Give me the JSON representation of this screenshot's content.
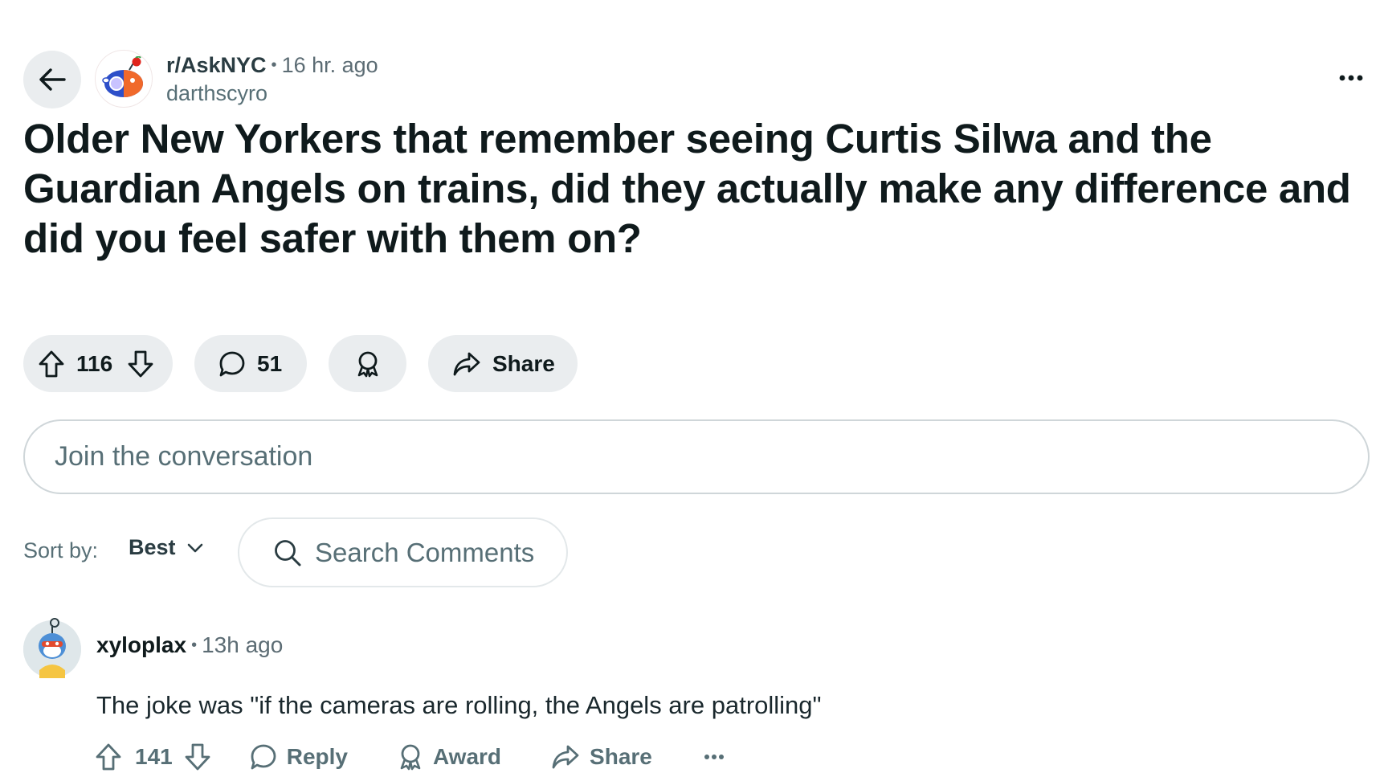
{
  "post": {
    "subreddit": "r/AskNYC",
    "separator": "•",
    "time_ago": "16 hr. ago",
    "author": "darthscyro",
    "title": "Older New Yorkers that remember seeing Curtis Silwa and the Guardian Angels on trains, did they actually make any difference and did you feel safer with them on?",
    "votes": "116",
    "comments": "51",
    "share_label": "Share"
  },
  "composer": {
    "placeholder": "Join the conversation"
  },
  "sort": {
    "label": "Sort by:",
    "value": "Best"
  },
  "search": {
    "placeholder": "Search Comments"
  },
  "comment": {
    "author": "xyloplax",
    "separator": "•",
    "time_ago": "13h ago",
    "body": "The joke was \"if the cameras are rolling, the Angels are patrolling\"",
    "votes": "141",
    "reply_label": "Reply",
    "award_label": "Award",
    "share_label": "Share"
  },
  "colors": {
    "pill_bg": "#eaedef",
    "text_primary": "#0f1a1c",
    "text_secondary": "#576f76",
    "nyc_blue": "#2d4fc9",
    "nyc_orange": "#f0692b"
  },
  "icons": [
    "back-arrow-icon",
    "subreddit-avatar-icon",
    "more-options-icon",
    "upvote-icon",
    "downvote-icon",
    "comment-icon",
    "award-icon",
    "share-icon",
    "search-icon",
    "chevron-down-icon",
    "user-avatar-icon"
  ]
}
